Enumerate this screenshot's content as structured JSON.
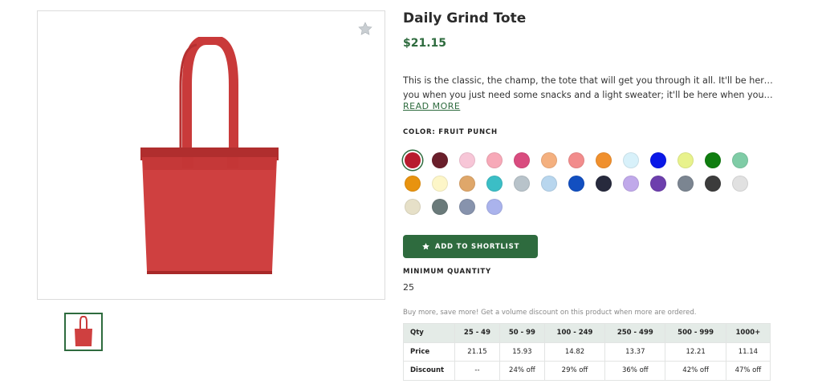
{
  "product": {
    "title": "Daily Grind Tote",
    "price": "$21.15",
    "description_lines": [
      "This is the classic, the champ, the tote that will get you through it all. It'll be here for",
      "you when you just need some snacks and a light sweater; it'll be here when you hav..."
    ],
    "read_more": "READ MORE",
    "color_label": "COLOR: FRUIT PUNCH"
  },
  "swatches": [
    {
      "color": "#b81c2e",
      "selected": true
    },
    {
      "color": "#6a1f2b"
    },
    {
      "color": "#f7c6d7"
    },
    {
      "color": "#f7a9b8"
    },
    {
      "color": "#d94c7f"
    },
    {
      "color": "#f4b07f"
    },
    {
      "color": "#f28c8c"
    },
    {
      "color": "#f0902e"
    },
    {
      "color": "#d8f1fa"
    },
    {
      "color": "#0a18e8"
    },
    {
      "color": "#e8f28c"
    },
    {
      "color": "#0f7d0f"
    },
    {
      "color": "#7fcca6"
    },
    {
      "color": "#e8930f"
    },
    {
      "color": "#fdf6c8"
    },
    {
      "color": "#dfa76a"
    },
    {
      "color": "#3bbec6"
    },
    {
      "color": "#b8c3ca"
    },
    {
      "color": "#b8d6ee"
    },
    {
      "color": "#124fc0"
    },
    {
      "color": "#272a3d"
    },
    {
      "color": "#c0a9ea"
    },
    {
      "color": "#6d3fad"
    },
    {
      "color": "#7b8591"
    },
    {
      "color": "#3c3c3c"
    },
    {
      "color": "#e1e1e1"
    },
    {
      "color": "#e6e0c8"
    },
    {
      "color": "#6a7a7a"
    },
    {
      "color": "#8793ad"
    },
    {
      "color": "#aab3ec"
    }
  ],
  "actions": {
    "add_to_shortlist": "ADD TO SHORTLIST"
  },
  "min_quantity": {
    "label": "MINIMUM QUANTITY",
    "value": "25"
  },
  "volume": {
    "note": "Buy more, save more! Get a volume discount on this product when more are ordered.",
    "headers": [
      "Qty",
      "25 - 49",
      "50 - 99",
      "100 - 249",
      "250 - 499",
      "500 - 999",
      "1000+"
    ],
    "rows": [
      [
        "Price",
        "21.15",
        "15.93",
        "14.82",
        "13.37",
        "12.21",
        "11.14"
      ],
      [
        "Discount",
        "--",
        "24% off",
        "29% off",
        "36% off",
        "42% off",
        "47% off"
      ]
    ]
  },
  "icons": {
    "favorite": "star-icon",
    "shortlist": "star-icon"
  }
}
